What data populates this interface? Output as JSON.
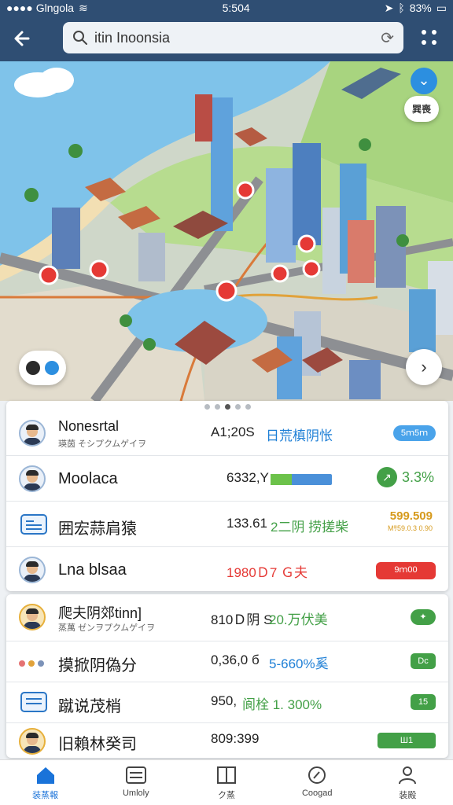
{
  "status_bar": {
    "carrier": "●●●● Glngola",
    "time": "5:504",
    "battery": "83%"
  },
  "header": {
    "search_value": "itin Inoonsia",
    "search_icon": "search-icon",
    "refresh_icon": "refresh-icon",
    "more_icon": "grid-dots-icon"
  },
  "map": {
    "badge_label": "巽喪",
    "chevron_icon": "chevron-down-icon",
    "next_icon": "chevron-right-icon"
  },
  "panel1": {
    "rows": [
      {
        "name": "Nonesrtal",
        "sub": "瑛茵 そシプクムゲイヲ",
        "value": "A1;20S",
        "value2": "日荒槙阴怅",
        "pill": "5ｍ5ｍ"
      },
      {
        "name": "Moolaca",
        "value": "6332,Y",
        "progress": 0.35,
        "trend": "3.3%"
      },
      {
        "name": "囲宏蒜肩猿",
        "value": "133.61",
        "value2": "2二阴 捞搓柴",
        "gold_a": "599.509",
        "gold_b": "Mｻ59.0.3 0.90"
      },
      {
        "name": "Lna blsaa",
        "value": "1980Ｄ7 Ｇ夫",
        "pill": "9ｍ00"
      }
    ]
  },
  "panel2": {
    "rows": [
      {
        "name": "爬夫阴郊tinn]",
        "sub": "蒸萬 ゼンヲプクムゲイヲ",
        "value": "810Ｄ阴 S",
        "value2": "20.万伏美",
        "pill": "✦"
      },
      {
        "name": "摸掀阴偽分",
        "value": "0,36,0 б",
        "value2": "5-660%奚",
        "pill": "Dc"
      },
      {
        "name": "蹴说茂梢",
        "value": "950,",
        "value2": "阆栓 1. 300%",
        "pill": "15"
      },
      {
        "name": "旧賴林癸司",
        "value": "809:399",
        "pill": "Ш1"
      }
    ]
  },
  "bottom_nav": [
    {
      "label": "装蒸報",
      "icon": "home-icon"
    },
    {
      "label": "Umloly",
      "icon": "list-icon"
    },
    {
      "label": "ク蒸",
      "icon": "book-icon"
    },
    {
      "label": "Coogad",
      "icon": "compass-icon"
    },
    {
      "label": "装殿",
      "icon": "profile-icon"
    }
  ],
  "colors": {
    "header": "#2f4e73",
    "accent_blue": "#1a73d9",
    "green": "#43a047",
    "red": "#e53935",
    "gold": "#d69a1c"
  }
}
